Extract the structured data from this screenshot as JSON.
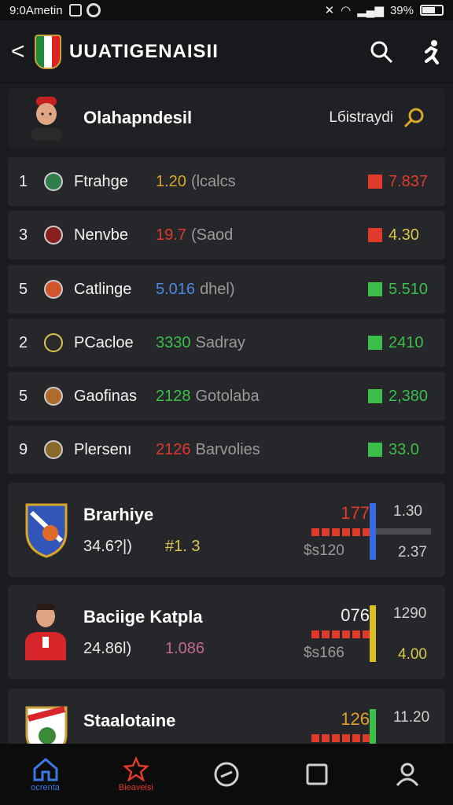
{
  "status": {
    "time": "9:0Ametin",
    "battery": "39%"
  },
  "header": {
    "back": "<",
    "title": "UUATIGENAISII"
  },
  "profile": {
    "name": "Olahapndesil",
    "link": "Lбistraydi"
  },
  "rows": [
    {
      "rank": "1",
      "name": "Ftrahge",
      "score": "1.20",
      "note": "(lcalcs",
      "value": "7.837",
      "color": "#d9a62a",
      "badge": "#2e7d4a",
      "ind": "#e03a2a"
    },
    {
      "rank": "3",
      "name": "Nenvbe",
      "score": "19.7",
      "note": "(Saod",
      "value": "4.30",
      "color": "#e03a2a",
      "badge": "#8a1f1f",
      "ind": "#e03a2a"
    },
    {
      "rank": "5",
      "name": "Catlinge",
      "score": "5.016",
      "note": "dhel)",
      "value": "5.510",
      "color": "#4a8ae0",
      "badge": "#d2542a",
      "ind": "#3bbf4a"
    },
    {
      "rank": "2",
      "name": "PCacloe",
      "score": "3330",
      "note": "Sadray",
      "value": "2410",
      "color": "#3bbf4a",
      "badge": "#2a2a2a",
      "ind": "#3bbf4a"
    },
    {
      "rank": "5",
      "name": "Gaofinas",
      "score": "2128",
      "note": "Gotolaba",
      "value": "2,380",
      "color": "#3bbf4a",
      "badge": "#b06a2a",
      "ind": "#3bbf4a"
    },
    {
      "rank": "9",
      "name": "Plersenı",
      "score": "2126",
      "note": "Barvolies",
      "value": "33.0",
      "color": "#e03a2a",
      "badge": "#8a6a2a",
      "ind": "#3bbf4a"
    }
  ],
  "cards": [
    {
      "name": "Brarhiye",
      "pct": "34.6?|)",
      "num": "#1. 3",
      "num_color": "#d9c84a",
      "top": "177",
      "top_color": "#e03a2a",
      "sub": "$s120",
      "r1": "1.30",
      "r2": "2.37",
      "r2_color": "#cfcfcf",
      "vcolor": "#3a6ae0"
    },
    {
      "name": "Baciige Katpla",
      "pct": "24.86l)",
      "num": "1.086",
      "num_color": "#c06a8a",
      "top": "076",
      "top_color": "#f2f2f2",
      "sub": "$s166",
      "r1": "1290",
      "r2": "4.00",
      "r2_color": "#d9c84a",
      "vcolor": "#d9c02a"
    },
    {
      "name": "Staalotaine",
      "pct": "",
      "num": "",
      "num_color": "#d9a62a",
      "top": "126",
      "top_color": "#e0a02a",
      "sub": "",
      "r1": "11.20",
      "r2": "",
      "r2_color": "#cfcfcf",
      "vcolor": "#3bbf4a"
    }
  ],
  "nav": [
    {
      "label": "ocrenta",
      "icon": "home-icon",
      "color": "#3a7ae0"
    },
    {
      "label": "Bieaveisi",
      "icon": "star-icon",
      "color": "#e03a2a"
    },
    {
      "label": "",
      "icon": "compass-icon",
      "color": "#cfcfcf"
    },
    {
      "label": "",
      "icon": "square-icon",
      "color": "#cfcfcf"
    },
    {
      "label": "",
      "icon": "user-icon",
      "color": "#cfcfcf"
    }
  ]
}
